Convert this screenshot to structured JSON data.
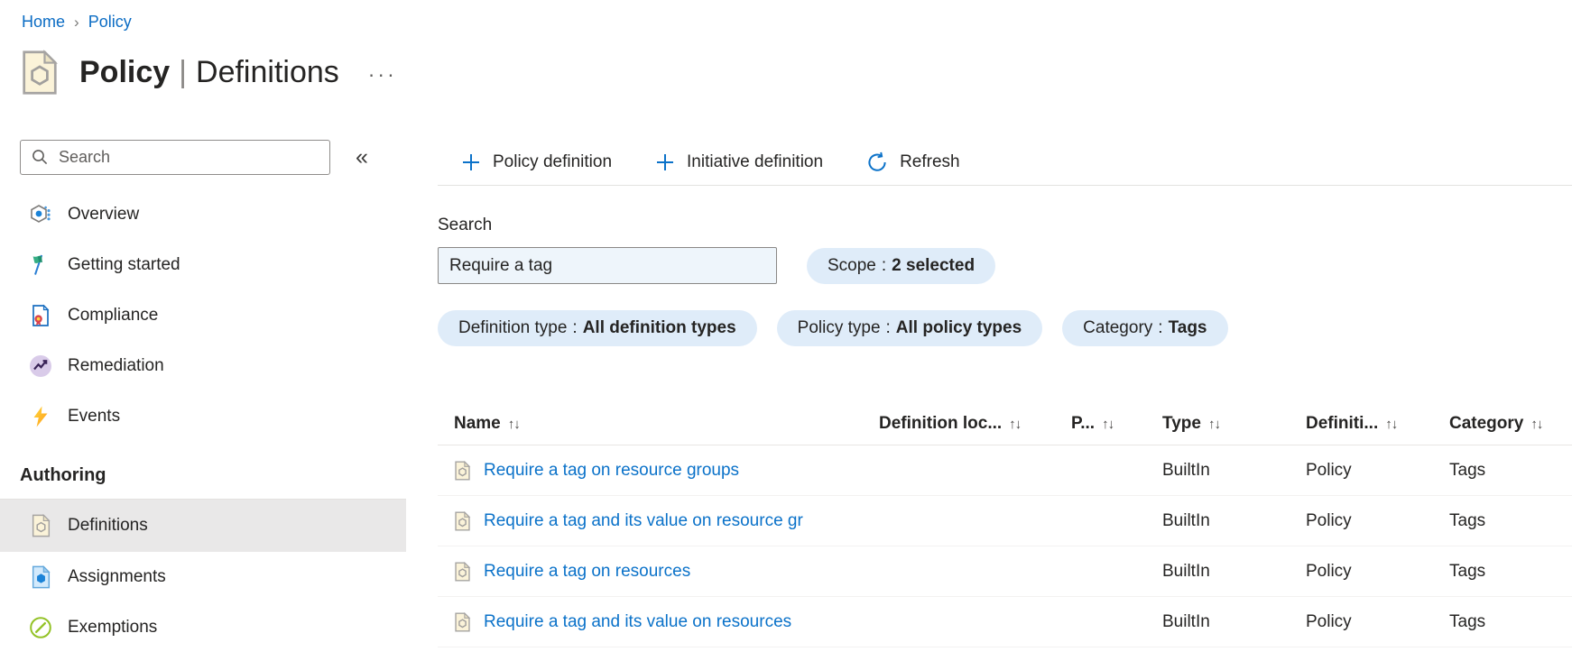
{
  "breadcrumb": {
    "separator": "›",
    "items": [
      {
        "label": "Home"
      },
      {
        "label": "Policy"
      }
    ]
  },
  "header": {
    "title_primary": "Policy",
    "title_divider": "|",
    "title_secondary": "Definitions",
    "more_glyph": "···"
  },
  "sidebar": {
    "search_placeholder": "Search",
    "collapse_glyph": "«",
    "items": [
      {
        "label": "Overview",
        "icon": "overview-icon"
      },
      {
        "label": "Getting started",
        "icon": "getting-started-icon"
      },
      {
        "label": "Compliance",
        "icon": "compliance-icon"
      },
      {
        "label": "Remediation",
        "icon": "remediation-icon"
      },
      {
        "label": "Events",
        "icon": "events-icon"
      }
    ],
    "authoring": {
      "section_label": "Authoring",
      "items": [
        {
          "label": "Definitions",
          "icon": "policy-definition-icon",
          "selected": true
        },
        {
          "label": "Assignments",
          "icon": "assignment-icon",
          "selected": false
        },
        {
          "label": "Exemptions",
          "icon": "exemption-icon",
          "selected": false
        }
      ]
    }
  },
  "toolbar": {
    "buttons": [
      {
        "label": "Policy definition",
        "icon": "plus-icon"
      },
      {
        "label": "Initiative definition",
        "icon": "plus-icon"
      },
      {
        "label": "Refresh",
        "icon": "refresh-icon"
      }
    ]
  },
  "filters": {
    "search_label": "Search",
    "search_value": "Require a tag",
    "separator": ":",
    "pills": [
      {
        "label": "Scope",
        "value": "2 selected"
      },
      {
        "label": "Definition type",
        "value": "All definition types"
      },
      {
        "label": "Policy type",
        "value": "All policy types"
      },
      {
        "label": "Category",
        "value": "Tags"
      }
    ]
  },
  "table": {
    "sort_glyph": "↑↓",
    "columns": [
      {
        "label": "Name"
      },
      {
        "label": "Definition loc..."
      },
      {
        "label": "P..."
      },
      {
        "label": "Type"
      },
      {
        "label": "Definiti..."
      },
      {
        "label": "Category"
      }
    ],
    "rows": [
      {
        "name": "Require a tag on resource groups",
        "definition_location": "",
        "policies": "",
        "type": "BuiltIn",
        "definition_type": "Policy",
        "category": "Tags"
      },
      {
        "name": "Require a tag and its value on resource gr",
        "definition_location": "",
        "policies": "",
        "type": "BuiltIn",
        "definition_type": "Policy",
        "category": "Tags"
      },
      {
        "name": "Require a tag on resources",
        "definition_location": "",
        "policies": "",
        "type": "BuiltIn",
        "definition_type": "Policy",
        "category": "Tags"
      },
      {
        "name": "Require a tag and its value on resources",
        "definition_location": "",
        "policies": "",
        "type": "BuiltIn",
        "definition_type": "Policy",
        "category": "Tags"
      }
    ]
  },
  "colors": {
    "accent_blue": "#0b72c9",
    "breadcrumb_link": "#0b6cc4",
    "pill_background": "#dfecf9",
    "selected_item_background": "#e9e8e8",
    "policy_icon_fill": "#fbf3d9",
    "search_input_background": "#eef5fb",
    "events_bolt": "#ffb602",
    "exemption_green": "#93c226",
    "remediation_lavender": "#d9cbe9"
  }
}
